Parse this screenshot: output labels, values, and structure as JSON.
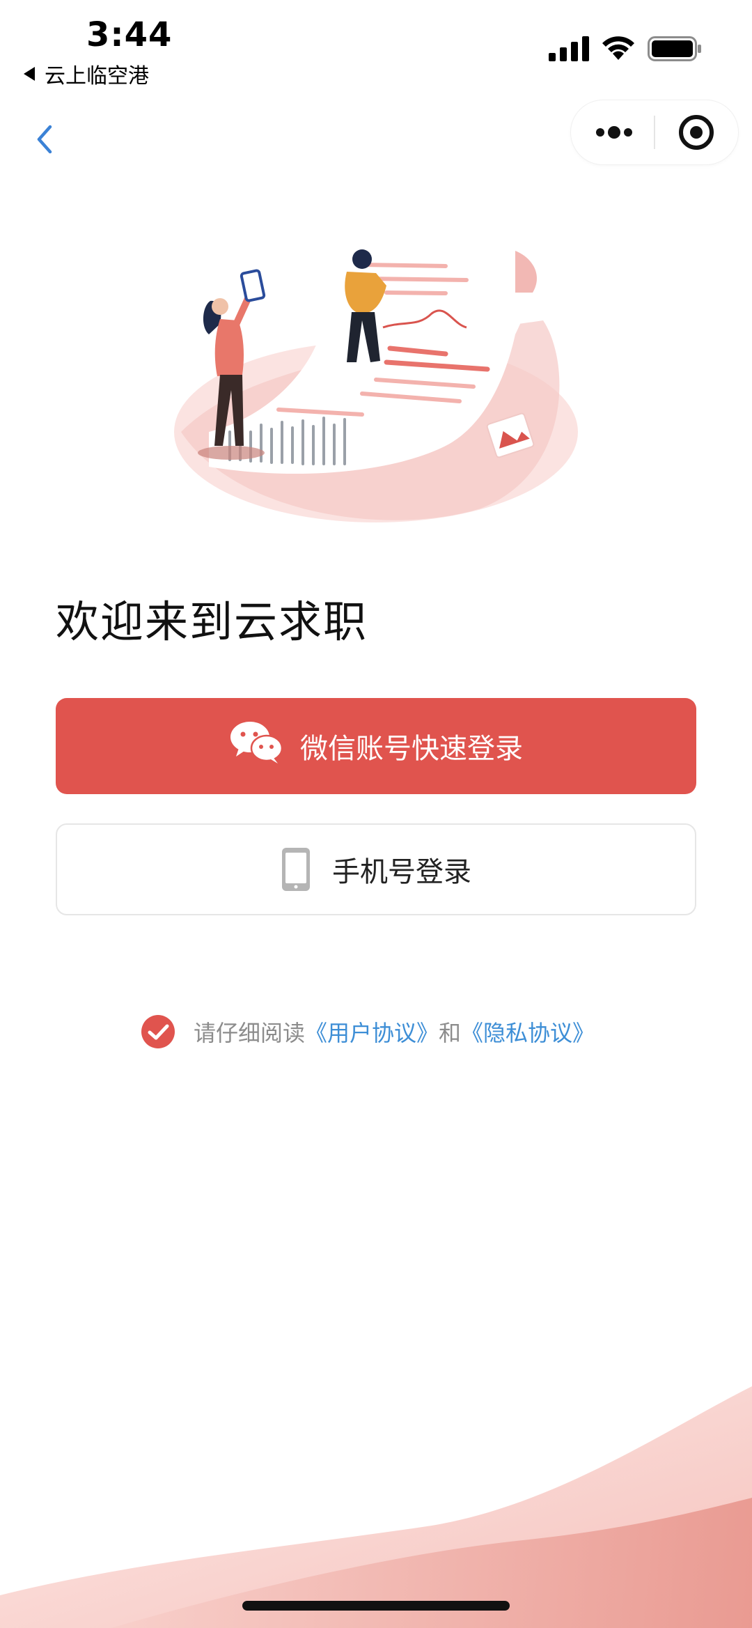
{
  "status_bar": {
    "time": "3:44",
    "back_app": "云上临空港"
  },
  "page": {
    "welcome_title": "欢迎来到云求职"
  },
  "buttons": {
    "wechat_login": "微信账号快速登录",
    "phone_login": "手机号登录"
  },
  "agreement": {
    "prefix": "请仔细阅读",
    "user_agreement": "《用户协议》",
    "conjunction": "和",
    "privacy_policy": "《隐私协议》",
    "checked": true
  },
  "colors": {
    "primary": "#e0544e",
    "link": "#3d8ed6",
    "muted_text": "#8c8c8c"
  },
  "icons": {
    "nav_back": "chevron-left-icon",
    "capsule_more": "more-dots-icon",
    "capsule_close": "target-circle-icon",
    "wechat": "wechat-icon",
    "phone": "phone-icon",
    "check": "checkmark-circle-icon"
  }
}
